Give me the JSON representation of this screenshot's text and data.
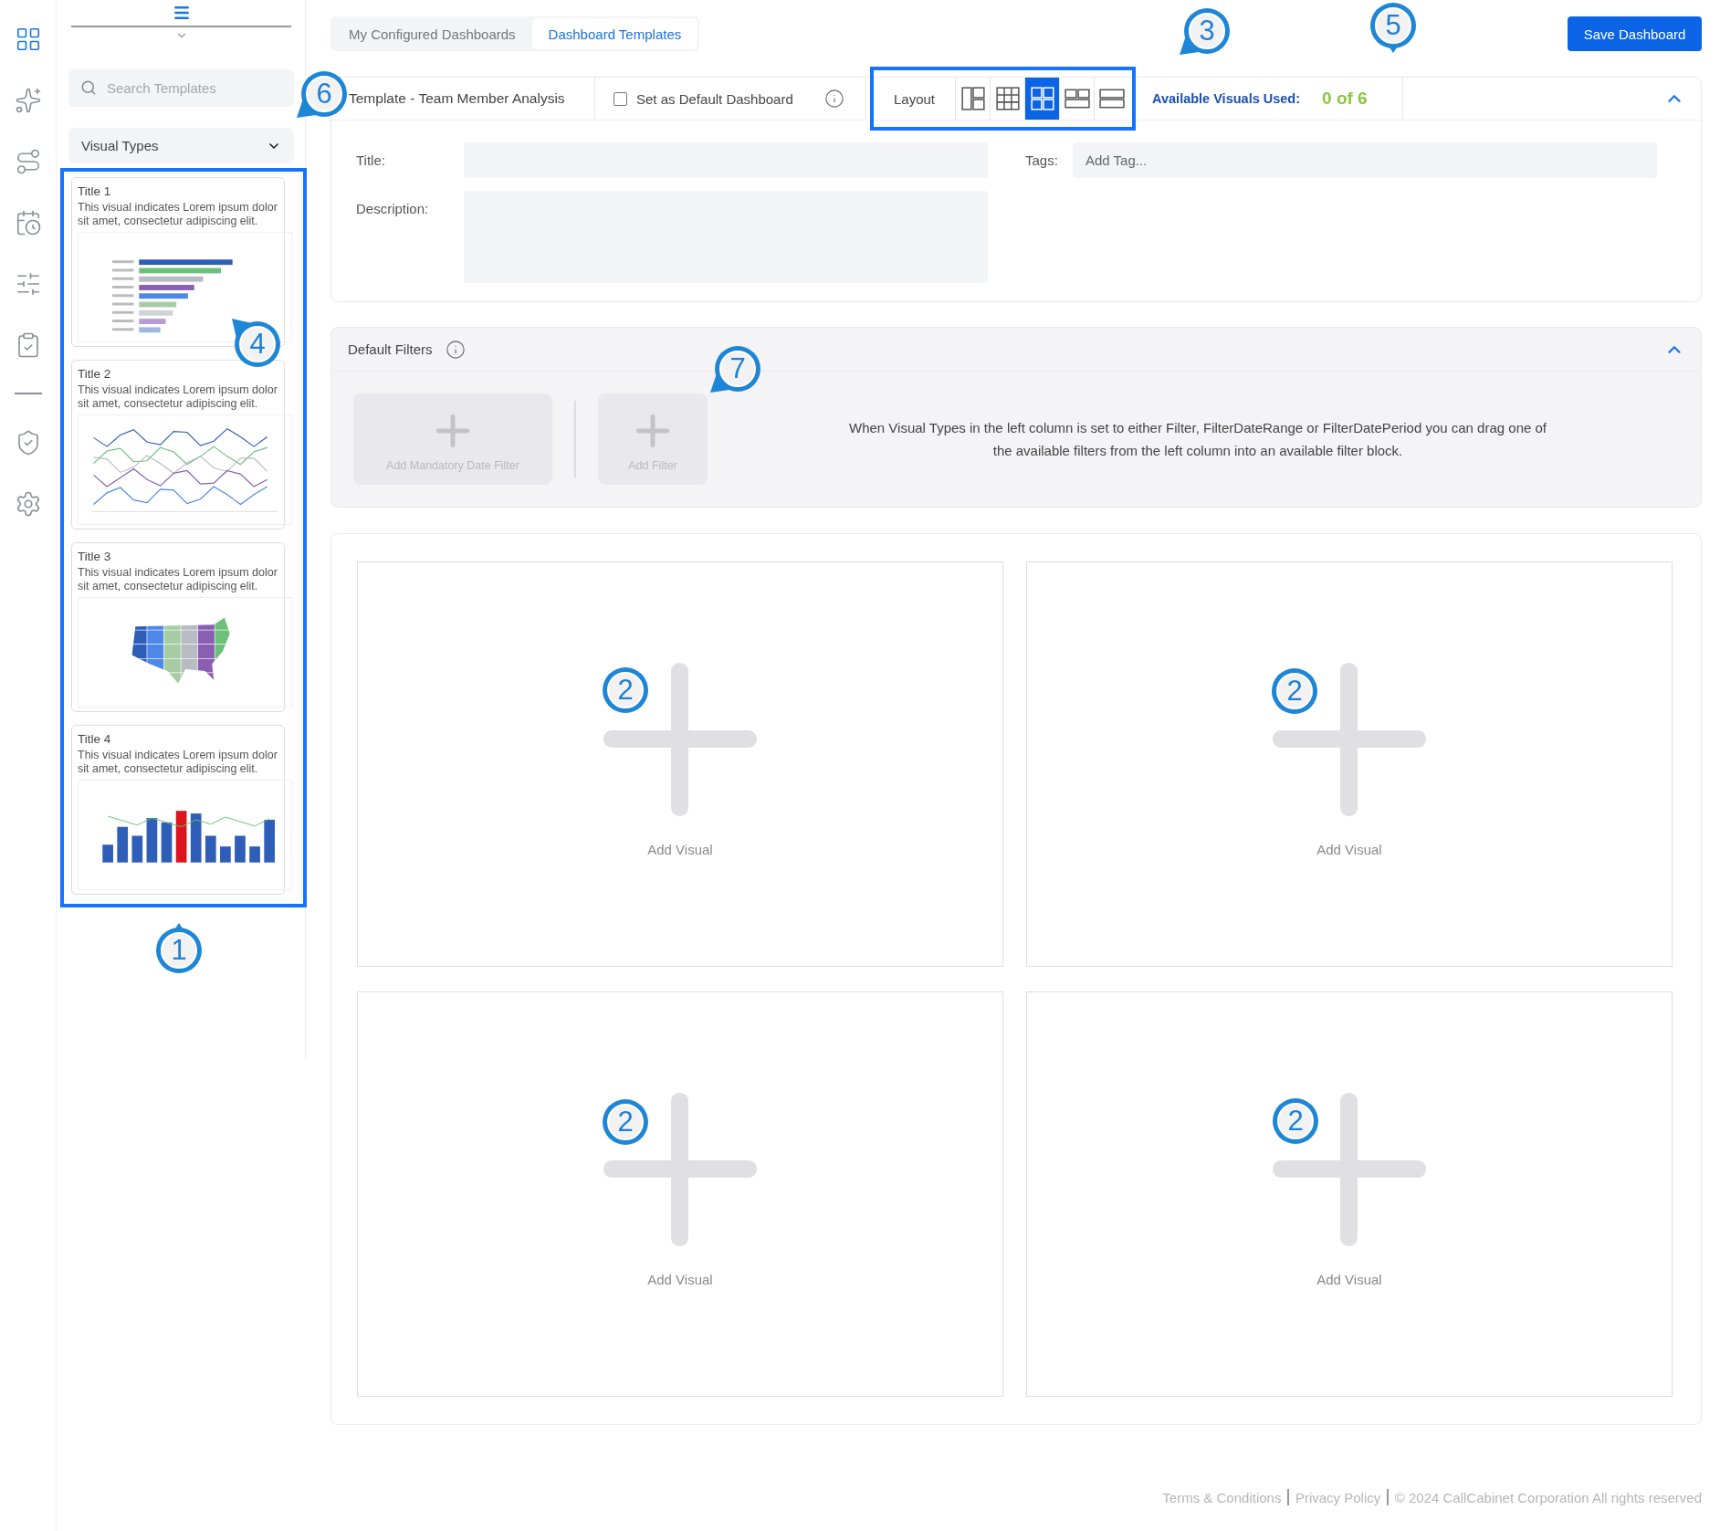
{
  "nav_items": [
    {
      "selected": true
    },
    {
      "selected": false
    },
    {
      "selected": false
    },
    {
      "selected": false
    },
    {
      "selected": false
    },
    {
      "selected": false
    },
    {
      "selected": false
    },
    {
      "selected": false
    }
  ],
  "left_panel": {
    "search": {
      "placeholder": "Search Templates"
    },
    "visual_types": {
      "value": "Visual Types"
    },
    "highlighted": true,
    "templates": [
      {
        "title": "Title 1",
        "description": "This visual indicates Lorem ipsum dolor sit amet, consectetur adipiscing elit.",
        "kind": "bar"
      },
      {
        "title": "Title 2",
        "description": "This visual indicates Lorem ipsum dolor sit amet, consectetur adipiscing elit.",
        "kind": "line"
      },
      {
        "title": "Title 3",
        "description": "This visual indicates Lorem ipsum dolor sit amet, consectetur adipiscing elit.",
        "kind": "map"
      },
      {
        "title": "Title 4",
        "description": "This visual indicates Lorem ipsum dolor sit amet, consectetur adipiscing elit.",
        "kind": "combo"
      }
    ]
  },
  "tabs": [
    {
      "label": "My Configured Dashboards",
      "selected": false
    },
    {
      "label": "Dashboard Templates",
      "selected": true
    }
  ],
  "save_button": "Save Dashboard",
  "header": {
    "template_name": "Template - Team Member Analysis",
    "default_checkbox": {
      "label": "Set as Default Dashboard",
      "checked": false
    },
    "layout": {
      "label": "Layout",
      "highlighted": true,
      "options": [
        {
          "selected": false
        },
        {
          "selected": false
        },
        {
          "selected": true
        },
        {
          "selected": false
        },
        {
          "selected": false
        }
      ]
    },
    "visuals_used": {
      "label": "Available Visuals Used:",
      "value": "0 of 6"
    },
    "expanded": true
  },
  "form": {
    "title_label": "Title:",
    "tags_label": "Tags:",
    "tags_placeholder": "Add Tag...",
    "description_label": "Description:"
  },
  "filters": {
    "title": "Default Filters",
    "expanded": true,
    "blocks": [
      {
        "label": "Add Mandatory Date Filter"
      },
      {
        "label": "Add Filter"
      }
    ],
    "hint": "When Visual Types in the left column is set to either Filter, FilterDateRange or FilterDatePeriod you can drag one of the available filters from the left column into an available filter block."
  },
  "visual_slots": [
    {
      "label": "Add Visual"
    },
    {
      "label": "Add Visual"
    },
    {
      "label": "Add Visual"
    },
    {
      "label": "Add Visual"
    }
  ],
  "footer": {
    "links": [
      "Terms & Conditions",
      "Privacy Policy"
    ],
    "copyright": "© 2024 CallCabinet Corporation All rights reserved"
  },
  "callouts": [
    {
      "number": "5"
    },
    {
      "number": "3"
    },
    {
      "number": "6"
    },
    {
      "number": "4"
    },
    {
      "number": "7"
    },
    {
      "number": "2"
    },
    {
      "number": "2"
    },
    {
      "number": "2"
    },
    {
      "number": "2"
    },
    {
      "number": "1"
    }
  ]
}
